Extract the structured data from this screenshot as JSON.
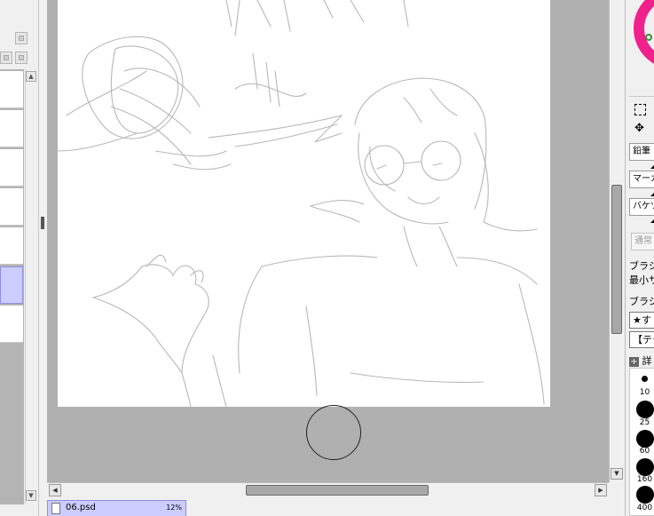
{
  "canvas": {
    "sketch_description_icon": "pencil-sketch"
  },
  "layer_panel": {
    "scroll_up": "▲",
    "scroll_down": "▼"
  },
  "scrollbars": {
    "left_arrow": "◀",
    "right_arrow": "▶",
    "up_arrow": "▲",
    "down_arrow": "▼"
  },
  "document_tab": {
    "name": "06.psd",
    "zoom": "12%"
  },
  "tools": {
    "select_icon": "⬚",
    "move_icon": "✥",
    "brush_slots": [
      {
        "label": "鉛筆"
      },
      {
        "label": "マーカ"
      },
      {
        "label": "バケツ"
      }
    ],
    "blend_mode": "通常",
    "brush_shape_label": "ブラシ",
    "min_size_label": "最小サ",
    "brush_texture_label": "ブラシ",
    "pick_1": "★す",
    "pick_2": "【テク",
    "detail_label": "詳",
    "sizes": [
      "10",
      "25",
      "60",
      "160",
      "400"
    ]
  },
  "colors": {
    "accent_selected": "#ccccff",
    "color_wheel": "#f0208c",
    "canvas_bg": "#b0b0b0"
  }
}
